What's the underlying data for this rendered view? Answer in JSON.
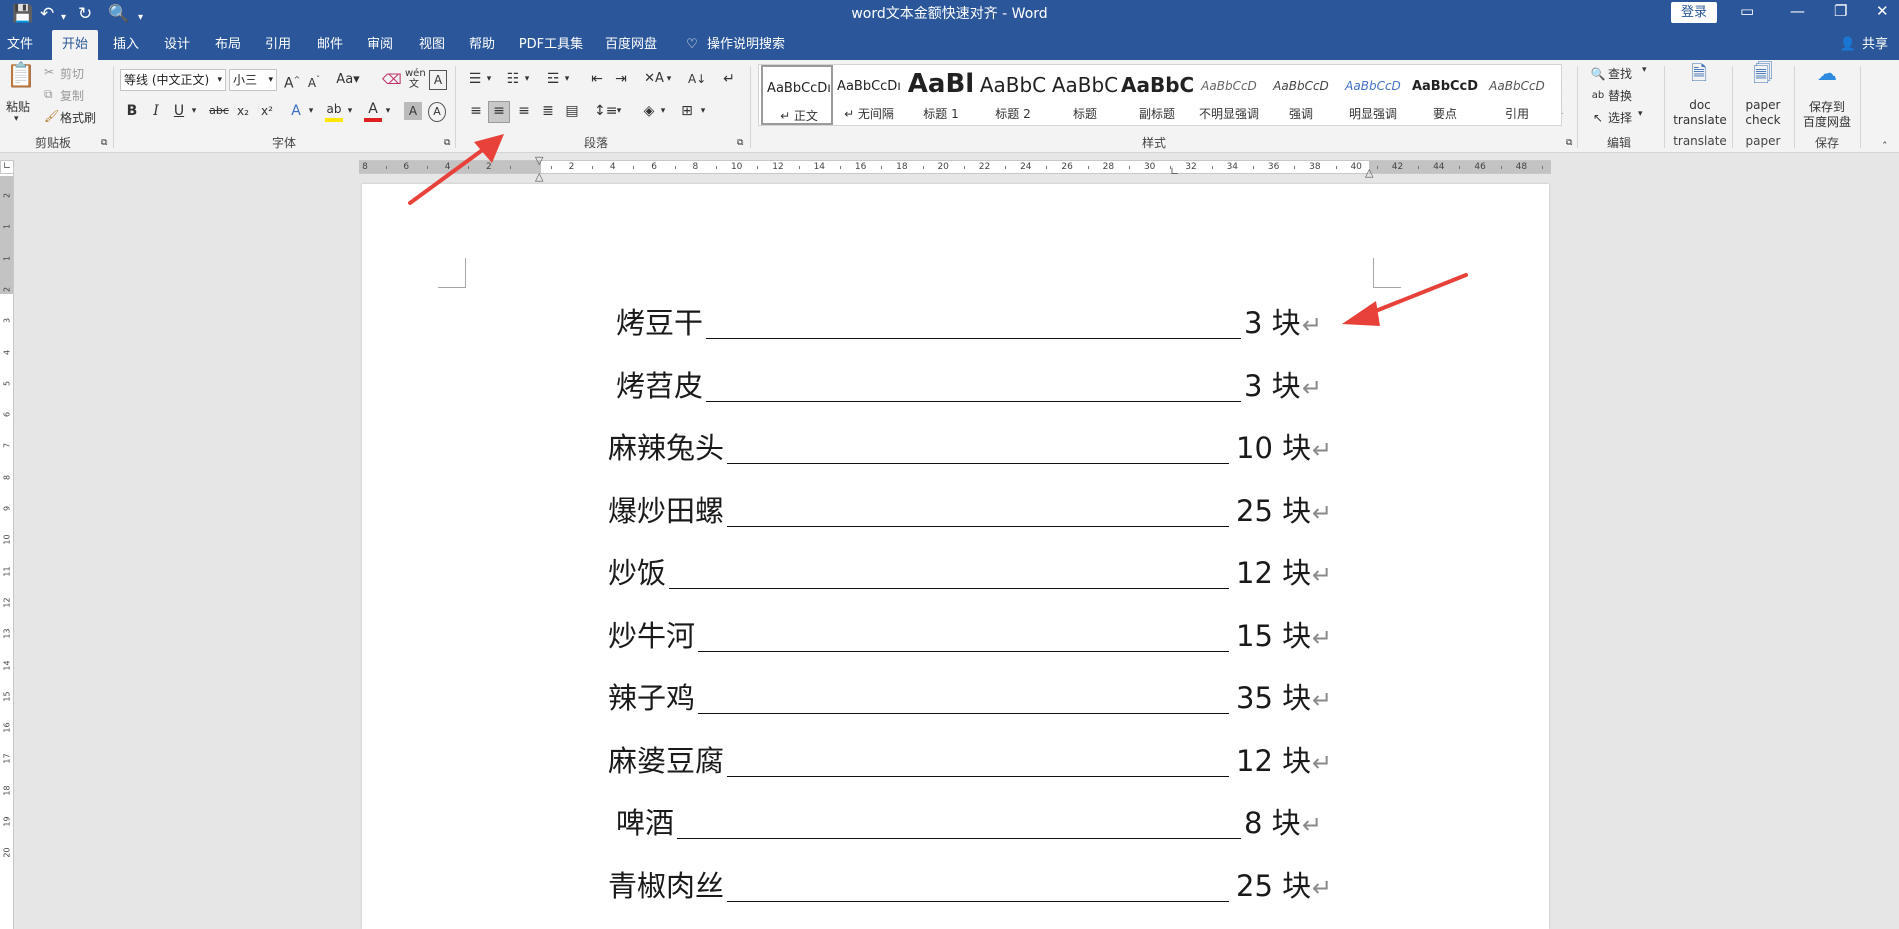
{
  "window": {
    "title": "word文本金额快速对齐  -  Word",
    "login_label": "登录",
    "share_label": "共享"
  },
  "tabs": [
    "文件",
    "开始",
    "插入",
    "设计",
    "布局",
    "引用",
    "邮件",
    "审阅",
    "视图",
    "帮助",
    "PDF工具集",
    "百度网盘"
  ],
  "tell_me": "操作说明搜索",
  "clipboard": {
    "paste": "粘贴",
    "cut": "剪切",
    "copy": "复制",
    "format_painter": "格式刷",
    "group": "剪贴板"
  },
  "font": {
    "name": "等线 (中文正文)",
    "size": "小三",
    "group": "字体"
  },
  "paragraph": {
    "group": "段落"
  },
  "styles": {
    "group": "样式",
    "items": [
      {
        "sample": "AaBbCcDı",
        "name": "↵ 正文"
      },
      {
        "sample": "AaBbCcDı",
        "name": "↵ 无间隔"
      },
      {
        "sample": "AaBl",
        "name": "标题 1"
      },
      {
        "sample": "AaBbC",
        "name": "标题 2"
      },
      {
        "sample": "AaBbC",
        "name": "标题"
      },
      {
        "sample": "AaBbC",
        "name": "副标题"
      },
      {
        "sample": "AaBbCcD",
        "name": "不明显强调"
      },
      {
        "sample": "AaBbCcD",
        "name": "强调"
      },
      {
        "sample": "AaBbCcD",
        "name": "明显强调"
      },
      {
        "sample": "AaBbCcD",
        "name": "要点"
      },
      {
        "sample": "AaBbCcD",
        "name": "引用"
      }
    ]
  },
  "editing": {
    "find": "查找",
    "replace": "替换",
    "select": "选择",
    "group": "编辑"
  },
  "addins": {
    "doc_translate_1": "doc",
    "doc_translate_2": "translate",
    "translate_group": "translate",
    "paper_check_1": "paper",
    "paper_check_2": "check",
    "paper_group": "paper",
    "baidu_1": "保存到",
    "baidu_2": "百度网盘",
    "save_group": "保存"
  },
  "ruler": {
    "h_ticks": [
      "8",
      "6",
      "4",
      "2",
      "",
      "2",
      "4",
      "6",
      "8",
      "10",
      "12",
      "14",
      "16",
      "18",
      "20",
      "22",
      "24",
      "26",
      "28",
      "30",
      "32",
      "34",
      "36",
      "38",
      "40",
      "42",
      "44",
      "46",
      "48"
    ],
    "v_ticks": [
      "2",
      "1",
      "1",
      "2",
      "3",
      "4",
      "5",
      "6",
      "7",
      "8",
      "9",
      "10",
      "11",
      "12",
      "13",
      "14",
      "15",
      "16",
      "17",
      "18",
      "19",
      "20"
    ]
  },
  "document": {
    "lines": [
      {
        "item": "烤豆干",
        "amount": "3 块"
      },
      {
        "item": "烤苕皮",
        "amount": "3 块"
      },
      {
        "item": "麻辣兔头",
        "amount": "10 块"
      },
      {
        "item": "爆炒田螺",
        "amount": "25 块"
      },
      {
        "item": "炒饭",
        "amount": "12 块"
      },
      {
        "item": "炒牛河",
        "amount": "15 块"
      },
      {
        "item": "辣子鸡",
        "amount": "35 块"
      },
      {
        "item": "麻婆豆腐",
        "amount": "12 块"
      },
      {
        "item": "啤酒",
        "amount": "8 块"
      },
      {
        "item": "青椒肉丝",
        "amount": "25 块"
      }
    ],
    "paragraph_mark": "↵"
  },
  "colors": {
    "titlebar": "#2b579a",
    "annotation_arrow": "#e8413a"
  }
}
